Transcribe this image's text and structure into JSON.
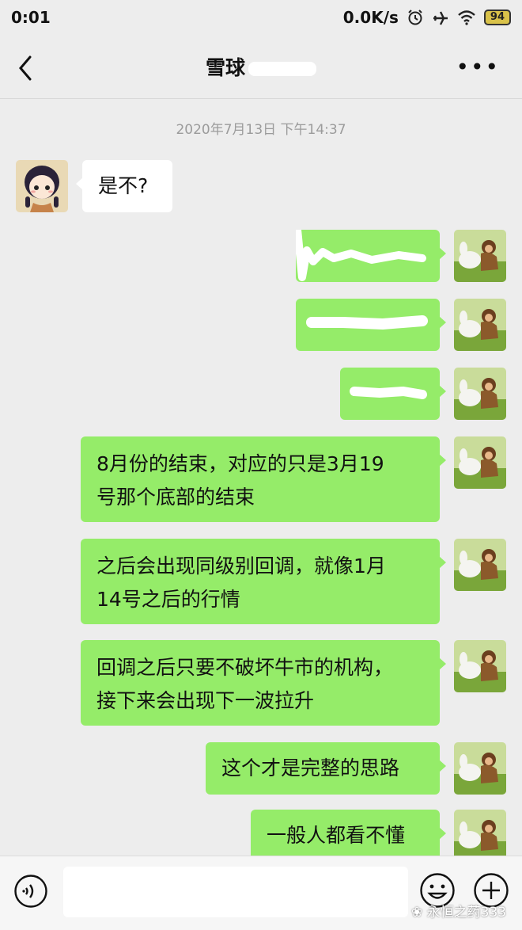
{
  "status_bar": {
    "time": "0:01",
    "network_speed": "0.0K/s",
    "battery": "94",
    "icons": [
      "alarm-icon",
      "airplane-icon",
      "wifi-icon",
      "battery-icon"
    ]
  },
  "header": {
    "title": "雪球",
    "back_icon": "chevron-left-icon",
    "more_icon": "more-dots-icon"
  },
  "timestamp": "2020年7月13日 下午14:37",
  "messages": [
    {
      "sender": "them",
      "text": "是不?"
    },
    {
      "sender": "me",
      "text": ""
    },
    {
      "sender": "me",
      "text": ""
    },
    {
      "sender": "me",
      "text": ""
    },
    {
      "sender": "me",
      "lines": [
        "8月份的结束，对应的只是3月19",
        "号那个底部的结束"
      ]
    },
    {
      "sender": "me",
      "lines": [
        "之后会出现同级别回调，就像1月",
        "14号之后的行情"
      ]
    },
    {
      "sender": "me",
      "lines": [
        "回调之后只要不破坏牛市的机构，",
        "接下来会出现下一波拉升"
      ]
    },
    {
      "sender": "me",
      "text": "这个才是完整的思路"
    },
    {
      "sender": "me",
      "text": "一般人都看不懂"
    }
  ],
  "input_bar": {
    "voice_icon": "voice-icon",
    "emoji_icon": "emoji-icon",
    "plus_icon": "plus-icon"
  },
  "watermark": "永恒之药333",
  "colors": {
    "background": "#ededed",
    "bubble_me": "#95ec69",
    "bubble_them": "#ffffff",
    "timestamp_text": "#9b9b9b"
  }
}
